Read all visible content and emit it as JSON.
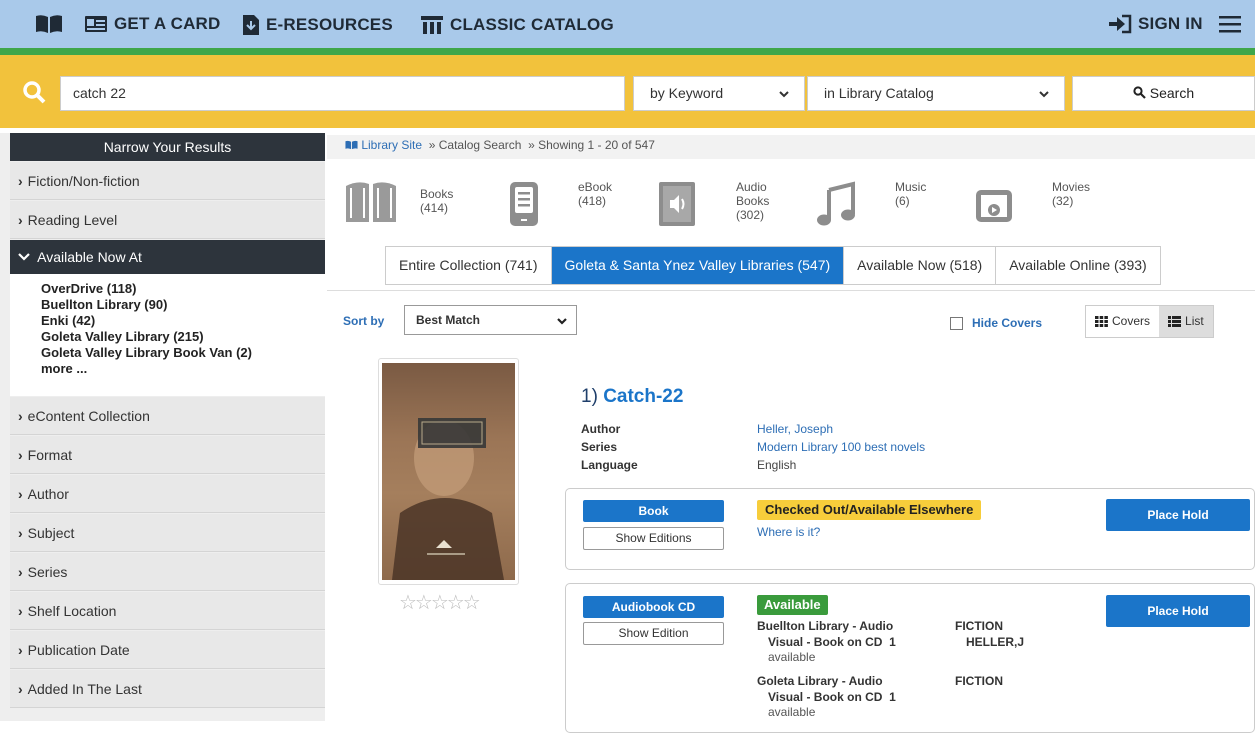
{
  "topbar": {
    "get_card": "GET A CARD",
    "e_resources": "E-RESOURCES",
    "classic_catalog": "CLASSIC CATALOG",
    "sign_in": "SIGN IN",
    "book_icon": "open-book-icon",
    "menu_icon": "hamburger-icon"
  },
  "search": {
    "query": "catch 22",
    "type": "by Keyword",
    "scope": "in Library Catalog",
    "button": "Search"
  },
  "sidebar": {
    "header": "Narrow Your Results",
    "facets_top": [
      "Fiction/Non-fiction",
      "Reading Level"
    ],
    "open_facet": "Available Now At",
    "open_items": [
      "OverDrive (118)",
      "Buellton Library (90)",
      "Enki (42)",
      "Goleta Valley Library (215)",
      "Goleta Valley Library Book Van (2)",
      "more ..."
    ],
    "facets_bottom": [
      "eContent Collection",
      "Format",
      "Author",
      "Subject",
      "Series",
      "Shelf Location",
      "Publication Date",
      "Added In The Last"
    ]
  },
  "breadcrumb": {
    "site": "Library Site",
    "catalog": "» Catalog Search",
    "showing": "» Showing 1 - 20 of 547"
  },
  "formats": [
    {
      "name": "Books",
      "count": "(414)"
    },
    {
      "name": "eBook",
      "count": "(418)"
    },
    {
      "name": "Audio",
      "name2": "Books",
      "count": "(302)"
    },
    {
      "name": "Music",
      "count": "(6)"
    },
    {
      "name": "Movies",
      "count": "(32)"
    }
  ],
  "tabs": [
    "Entire Collection (741)",
    "Goleta & Santa Ynez Valley Libraries (547)",
    "Available Now (518)",
    "Available Online (393)"
  ],
  "sort": {
    "label": "Sort by",
    "value": "Best Match"
  },
  "hide_covers": "Hide Covers",
  "view": {
    "covers": "Covers",
    "list": "List"
  },
  "result": {
    "title": "Catch-22",
    "number": "1)",
    "author_label": "Author",
    "author": "Heller, Joseph",
    "series_label": "Series",
    "series": "Modern Library 100 best novels",
    "language_label": "Language",
    "language": "English",
    "editions": [
      {
        "format": "Book",
        "secondary": "Show Editions",
        "status": "Checked Out/Available Elsewhere",
        "link": "Where is it?",
        "action": "Place Hold"
      },
      {
        "format": "Audiobook CD",
        "secondary": "Show Edition",
        "status": "Available",
        "action": "Place Hold",
        "copies": [
          {
            "loc1": "Buellton Library - Audio",
            "loc2": "Visual - Book on CD",
            "num": "1",
            "avail": "available",
            "call1": "FICTION",
            "call2": "HELLER,J"
          },
          {
            "loc1": "Goleta Library - Audio",
            "loc2": "Visual - Book on CD",
            "num": "1",
            "avail": "available",
            "call1": "FICTION",
            "call2": ""
          }
        ]
      }
    ]
  }
}
